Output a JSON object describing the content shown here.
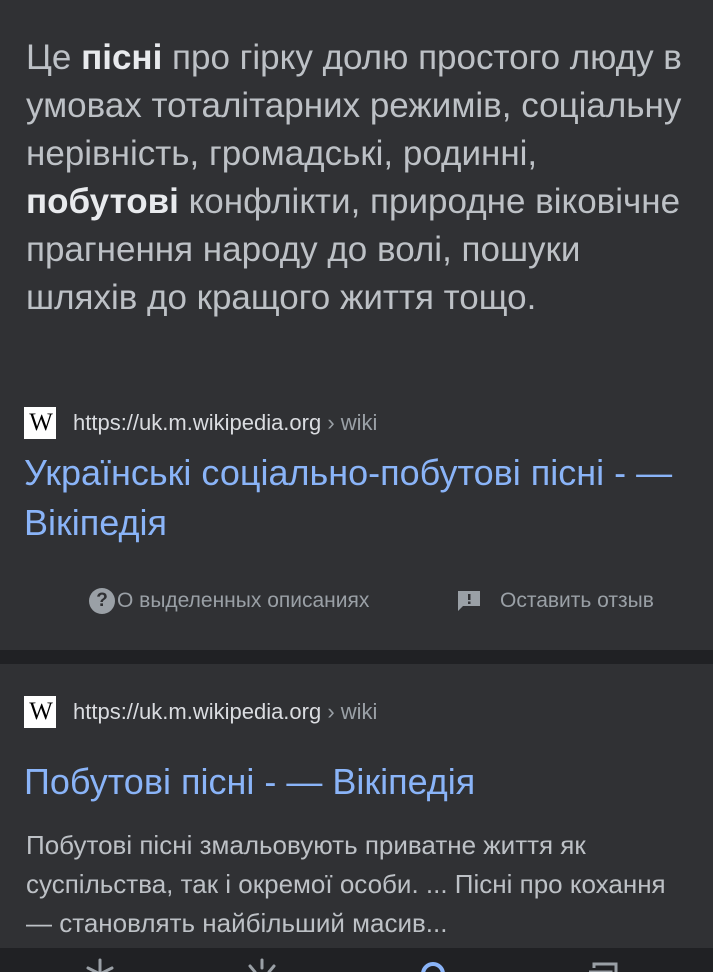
{
  "result1": {
    "snippet_parts": {
      "p1": "Це ",
      "b1": "пісні",
      "p2": " про гірку долю простого люду в умовах тоталітарних режимів, соціальну нерівність, громадські, родинні, ",
      "b2": "побутові",
      "p3": " конфлікти, природне віковічне прагнення народу до волі, пошуки шляхів до кращого життя тощо."
    },
    "favicon_text": "W",
    "url": "https://uk.m.wikipedia.org",
    "breadcrumb": " › wiki",
    "title": "Українські соціально-побутові пісні - — Вікіпедія",
    "about_label": "О выделенных описаниях",
    "feedback_label": "Оставить отзыв"
  },
  "result2": {
    "favicon_text": "W",
    "url": "https://uk.m.wikipedia.org",
    "breadcrumb": " › wiki",
    "title": "Побутові пісні - — Вікіпедія",
    "description": "Побутові пісні змальовують приватне життя як суспільства, так і окремої особи. ... Пісні про кохання — становлять найбільший масив..."
  },
  "icons": {
    "help": "help-circle-icon",
    "feedback": "feedback-icon",
    "nav": [
      "discover-icon",
      "updates-icon",
      "search-icon",
      "collections-icon"
    ]
  },
  "colors": {
    "background": "#202124",
    "card": "#303134",
    "link": "#8ab4f8",
    "text": "#bdc1c6"
  }
}
